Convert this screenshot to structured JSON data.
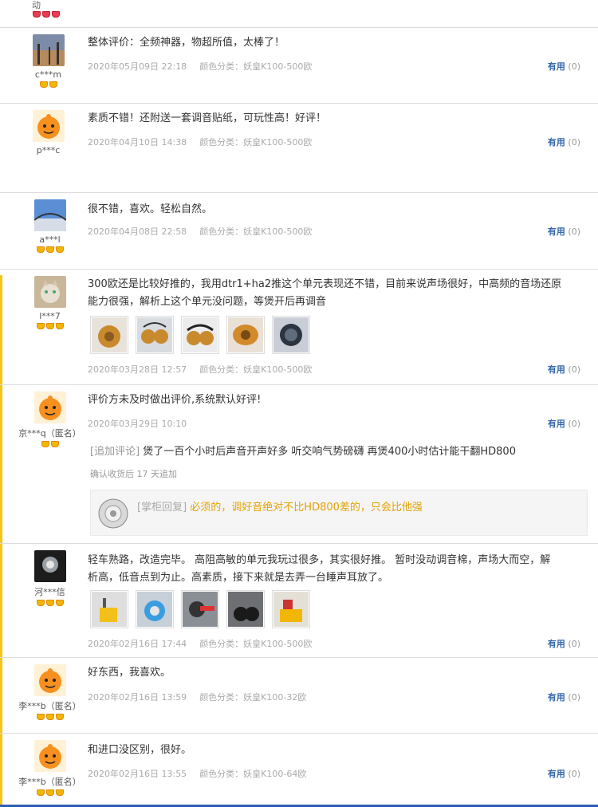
{
  "top": {
    "user": "动"
  },
  "reviews": [
    {
      "user": "c***m",
      "text": "整体评价：全频神器，物超所值，太棒了！",
      "date": "2020年05月09日 22:18",
      "color_label": "颜色分类：妖皇K100-500欧"
    },
    {
      "user": "p***c",
      "text": "素质不错！还附送一套调音贴纸，可玩性高！好评！",
      "date": "2020年04月10日 14:38",
      "color_label": "颜色分类：妖皇K100-500欧"
    },
    {
      "user": "a***l",
      "text": "很不错，喜欢。轻松自然。",
      "date": "2020年04月08日 22:58",
      "color_label": "颜色分类：妖皇K100-500欧"
    },
    {
      "user": "l***7",
      "text_line1": "300欧还是比较好推的，我用dtr1+ha2推这个单元表现还不错，目前来说声场很好，中高频的音场还原",
      "text_line2": "能力很强，解析上这个单元没问题，等煲开后再调音",
      "date": "2020年03月28日 12:57",
      "color_label": "颜色分类：妖皇K100-500欧"
    },
    {
      "user": "京***q（匿名）",
      "text": "评价方未及时做出评价,系统默认好评!",
      "date": "2020年03月29日 10:10",
      "append_tag": "[追加评论]",
      "append_text": "煲了一百个小时后声音开声好多 听交响气势磅礴 再煲400小时估计能干翻HD800",
      "append_meta": "确认收货后 17 天追加",
      "reply_tag": "[掌柜回复]",
      "reply_text": "必须的，调好音绝对不比HD800差的，只会比他强"
    },
    {
      "user": "河***信",
      "text_line1": "轻车熟路，改造完毕。 高阻高敏的单元我玩过很多，其实很好推。 暂时没动调音棉，声场大而空，解",
      "text_line2": "析高，低音点到为止。高素质，接下来就是去弄一台睡声耳放了。",
      "date": "2020年02月16日 17:44",
      "color_label": "颜色分类：妖皇K100-500欧"
    },
    {
      "user": "李***b（匿名）",
      "text": "好东西，我喜欢。",
      "date": "2020年02月16日 13:59",
      "color_label": "颜色分类：妖皇K100-32欧"
    },
    {
      "user": "李***b（匿名）",
      "text": "和进口没区别，很好。",
      "date": "2020年02月16日 13:55",
      "color_label": "颜色分类：妖皇K100-64欧"
    }
  ],
  "useful": {
    "label": "有用",
    "count": "(0)"
  },
  "colors": {
    "link": "#3366aa",
    "accent_bar": "#f5c518",
    "reply": "#e4a200",
    "bottom_bar": "#2f5db0"
  }
}
